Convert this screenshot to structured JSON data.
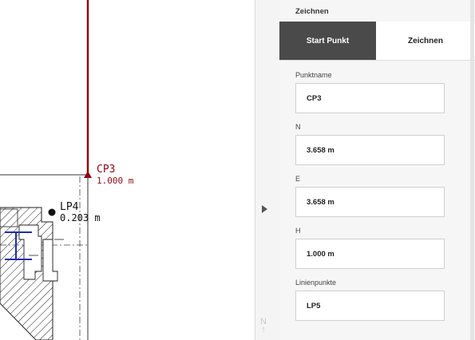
{
  "canvas": {
    "points": [
      {
        "name": "CP3",
        "value": "1.000 m",
        "color": "#8b0a14"
      },
      {
        "name": "LP4",
        "value": "0.203 m",
        "color": "#111111"
      }
    ],
    "north_label": "N"
  },
  "panel": {
    "title": "Zeichnen",
    "tabs": [
      {
        "label": "Start Punkt",
        "active": true
      },
      {
        "label": "Zeichnen",
        "active": false
      }
    ],
    "fields": [
      {
        "label": "Punktname",
        "value": "CP3"
      },
      {
        "label": "N",
        "value": "3.658 m"
      },
      {
        "label": "E",
        "value": "3.658 m"
      },
      {
        "label": "H",
        "value": "1.000 m"
      },
      {
        "label": "Linienpunkte",
        "value": "LP5"
      }
    ]
  },
  "icons": {
    "collapse": "chevron-right-icon",
    "north": "north-arrow-icon"
  },
  "colors": {
    "accent_dark": "#4a4a4a",
    "cp_red": "#8b0a14",
    "blue_lines": "#1f2fa8"
  }
}
